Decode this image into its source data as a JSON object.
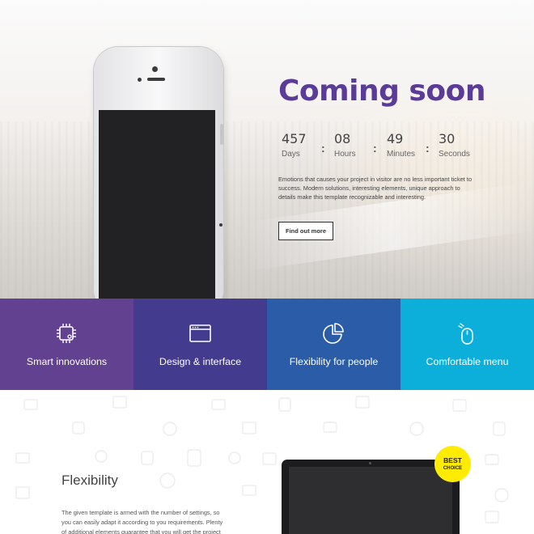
{
  "hero": {
    "title": "Coming soon",
    "countdown": [
      {
        "value": "457",
        "label": "Days"
      },
      {
        "value": "08",
        "label": "Hours"
      },
      {
        "value": "49",
        "label": "Minutes"
      },
      {
        "value": "30",
        "label": "Seconds"
      }
    ],
    "separator": ":",
    "description": "Emotions that causes your project in visitor are no less important ticket to success. Modern solutions, interesting elements, unique approach to details make this template recognizable and interesting.",
    "cta_label": "Find out more"
  },
  "features": [
    {
      "label": "Smart innovations",
      "icon": "chip-icon",
      "color": "#624191"
    },
    {
      "label": "Design & interface",
      "icon": "browser-window-icon",
      "color": "#433b8e"
    },
    {
      "label": "Flexibility for people",
      "icon": "pie-chart-icon",
      "color": "#2a5ca7"
    },
    {
      "label": "Comfortable menu",
      "icon": "mouse-icon",
      "color": "#0cafd9"
    }
  ],
  "flexibility": {
    "title": "Flexibility",
    "text": "The given template is armed with the number of settings, so you can easily adapt it according to you requirements. Plenty of additional elements guarantee that you will get the project"
  },
  "badge": {
    "line1": "BEST",
    "line2": "CHOICE"
  },
  "colors": {
    "title": "#5b3b98",
    "badge": "#ffec00"
  }
}
